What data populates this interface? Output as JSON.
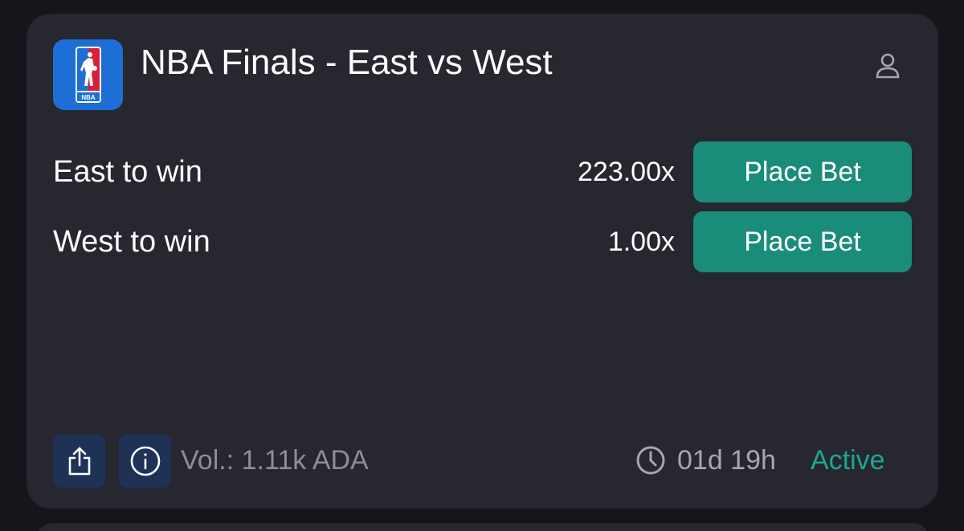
{
  "market": {
    "title": "NBA Finals - East vs West",
    "logo_icon": "nba-logo-icon",
    "account_icon": "user-icon"
  },
  "outcomes": [
    {
      "label": "East to win",
      "odds": "223.00x",
      "button_label": "Place Bet"
    },
    {
      "label": "West to win",
      "odds": "1.00x",
      "button_label": "Place Bet"
    }
  ],
  "footer": {
    "share_icon": "share-icon",
    "info_icon": "info-icon",
    "volume": "Vol.: 1.11k ADA",
    "clock_icon": "clock-icon",
    "time_remaining": "01d 19h",
    "status": "Active"
  },
  "colors": {
    "background": "#15161b",
    "card": "#26272f",
    "accent_button": "#1a8c7a",
    "status_active": "#1fa690",
    "icon_button": "#1e3258",
    "logo_blue": "#1d6fd6",
    "logo_red": "#d6213a"
  }
}
